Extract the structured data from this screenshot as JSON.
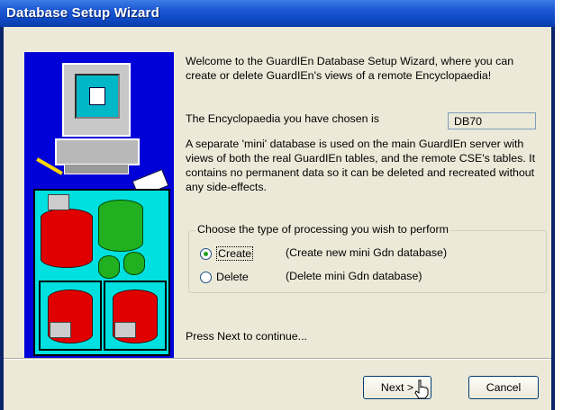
{
  "window": {
    "title": "Database Setup Wizard"
  },
  "intro": "Welcome to the GuardIEn Database Setup Wizard, where you can create or delete GuardIEn's views of a remote Encyclopaedia!",
  "encyclopaedia": {
    "label": "The Encyclopaedia you have chosen is",
    "value": "DB70"
  },
  "description": "A separate 'mini' database is used on the main GuardIEn server with views of both the real GuardIEn tables, and the remote CSE's tables.  It contains no permanent data so it can be deleted and recreated without any side-effects.",
  "processing": {
    "legend": "Choose the type of processing you wish to perform",
    "options": [
      {
        "label": "Create",
        "description": "(Create new mini Gdn database)",
        "selected": true
      },
      {
        "label": "Delete",
        "description": "(Delete mini Gdn database)",
        "selected": false
      }
    ]
  },
  "prompt": "Press Next to continue...",
  "buttons": {
    "next": "Next >",
    "cancel": "Cancel"
  },
  "colors": {
    "titlebar": "#0a246a",
    "face": "#ece9d8",
    "graphic_bg": "#0000d8"
  }
}
